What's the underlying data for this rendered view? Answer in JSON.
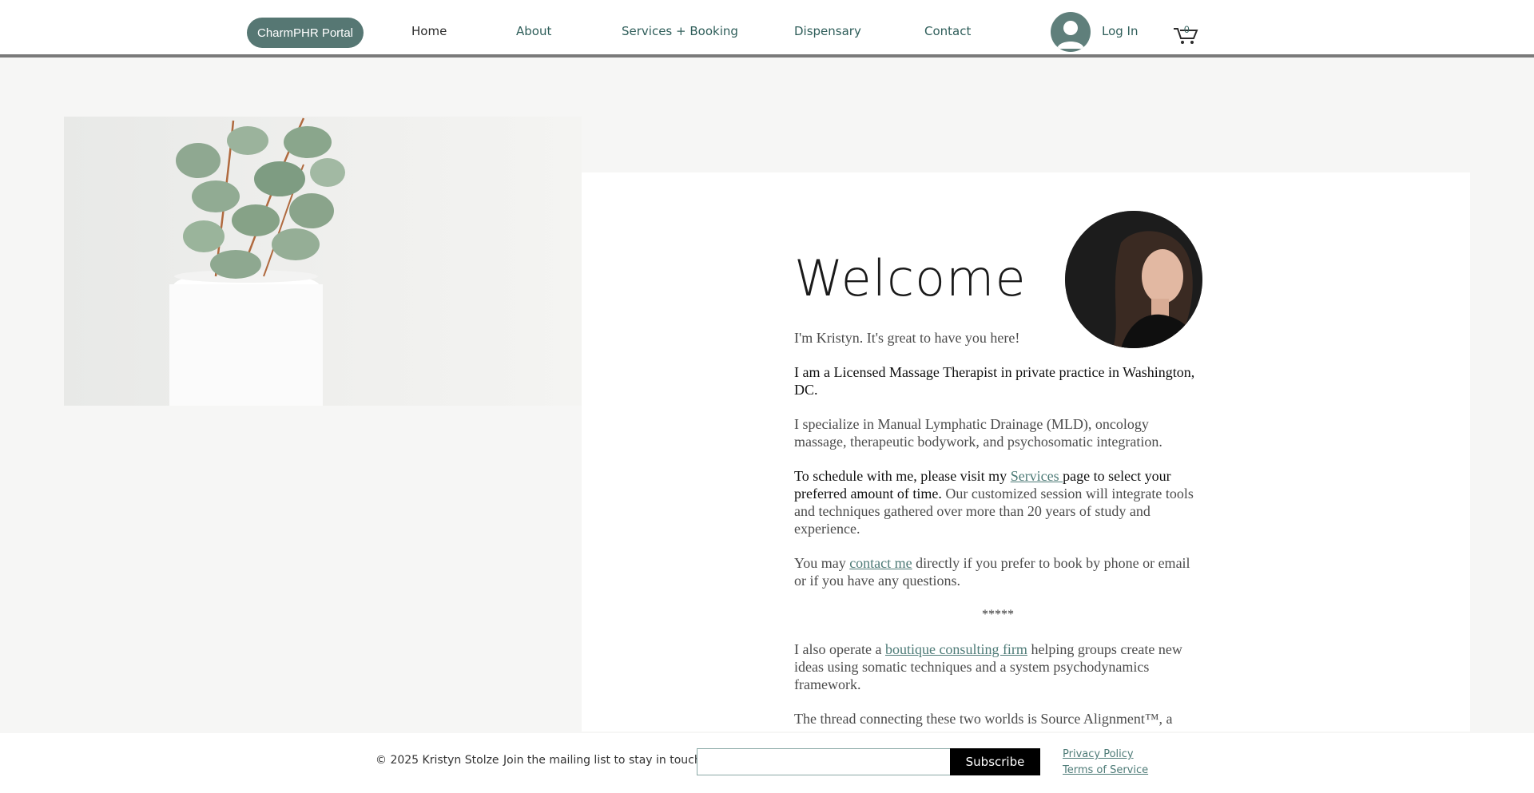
{
  "header": {
    "portal_label": "CharmPHR Portal",
    "nav": [
      "Home",
      "About",
      "Services + Booking",
      "Dispensary",
      "Contact"
    ],
    "login_label": "Log In",
    "cart_count": "0"
  },
  "main": {
    "title": "Welcome",
    "intro": "I'm Kristyn. It's great to have you here!",
    "p1": "I am a Licensed Massage Therapist in private practice in Washington, DC.",
    "p2": "I specialize in Manual Lymphatic Drainage (MLD), oncology massage, therapeutic bodywork, and psychosomatic integration.",
    "p3_start": "To schedule with me, please visit my ",
    "p3_link": "Services ",
    "p3_mid": "page to select your preferred amount of time.",
    "p3_end": " Our customized session will integrate tools and techniques gathered over more than 20 years of study and experience.",
    "p4_start": "You may ",
    "p4_link": "contact me",
    "p4_end": " directly if you prefer to book by phone or email or if you have any questions.",
    "divider": "*****",
    "p5_start": "I also operate a ",
    "p5_link": "boutique consulting firm",
    "p5_end": " helping groups create new ideas using somatic techniques and a system psychodynamics framework.",
    "p6": "The thread connecting these two worlds is Source Alignment™, a"
  },
  "footer": {
    "copyright": "© 2025 Kristyn Stolze",
    "mailing_text": "Join the mailing list to stay in touch!",
    "subscribe_label": "Subscribe",
    "privacy": "Privacy Policy ",
    "terms": "Terms of Service"
  },
  "colors": {
    "accent": "#567773",
    "link": "#4e7b77"
  },
  "icons": [
    "avatar-icon",
    "cart-icon"
  ]
}
